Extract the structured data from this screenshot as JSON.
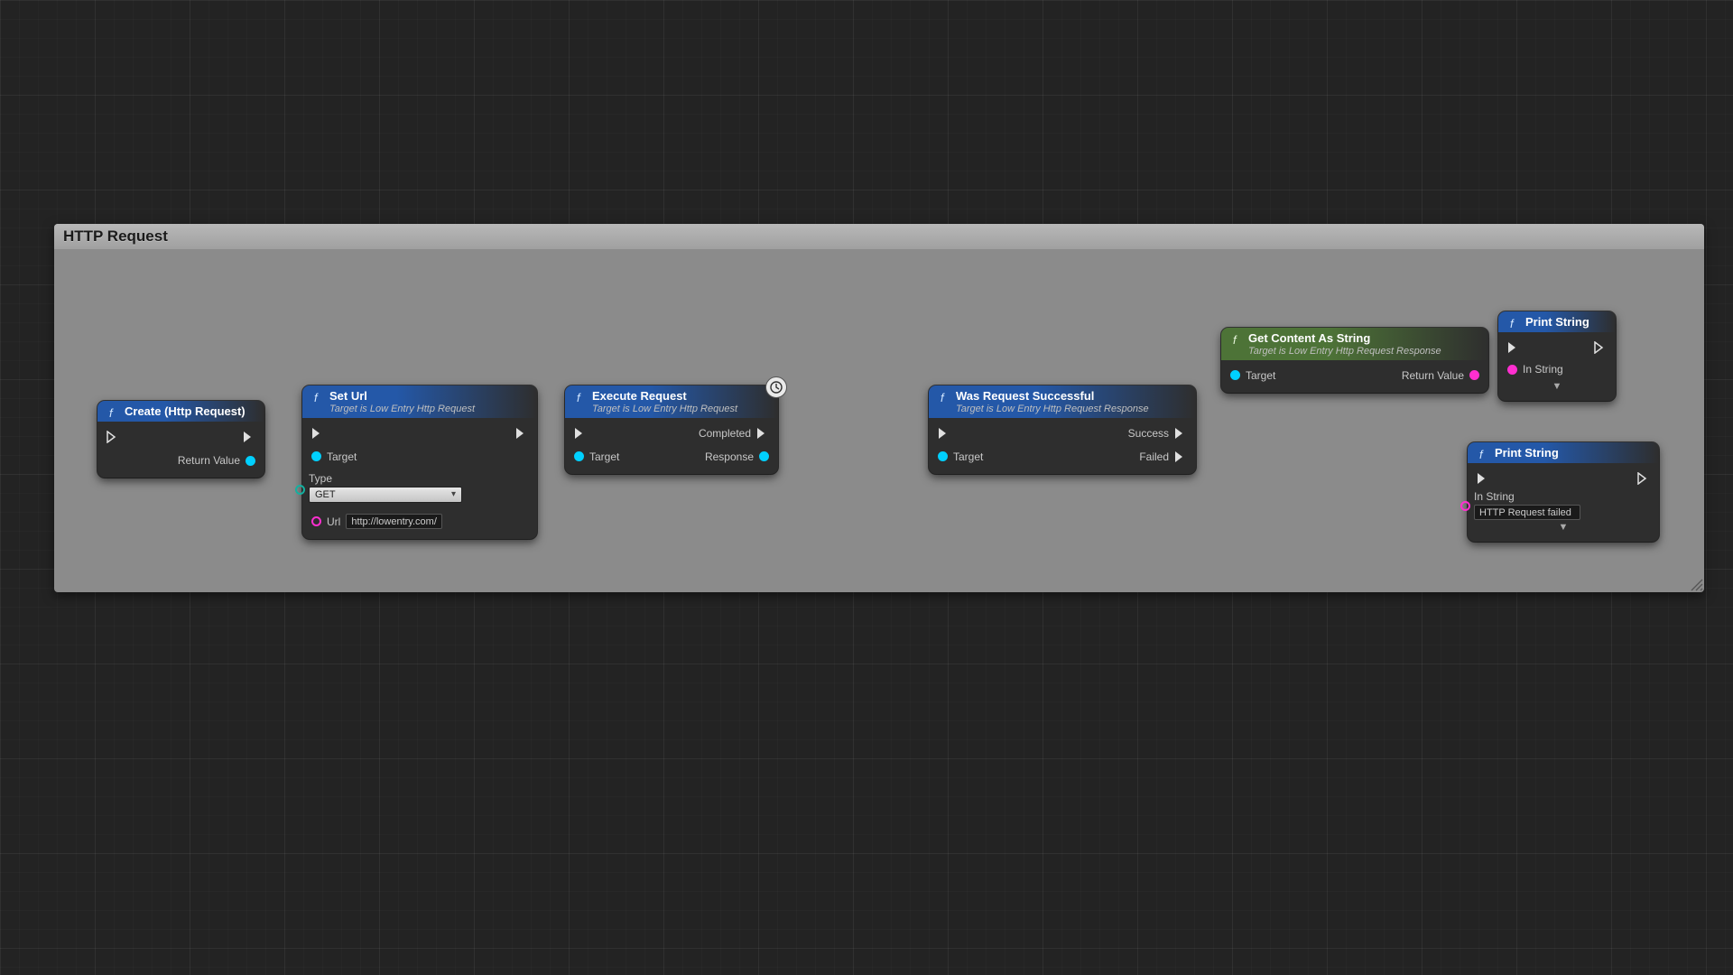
{
  "panel": {
    "title": "HTTP Request"
  },
  "nodes": {
    "create": {
      "title": "Create (Http Request)",
      "return": "Return Value"
    },
    "seturl": {
      "title": "Set Url",
      "subtitle": "Target is Low Entry Http Request",
      "target": "Target",
      "type_label": "Type",
      "type_value": "GET",
      "url_label": "Url",
      "url_value": "http://lowentry.com/"
    },
    "exec": {
      "title": "Execute Request",
      "subtitle": "Target is Low Entry Http Request",
      "target": "Target",
      "completed": "Completed",
      "response": "Response"
    },
    "success": {
      "title": "Was Request Successful",
      "subtitle": "Target is Low Entry Http Request Response",
      "target": "Target",
      "success": "Success",
      "failed": "Failed"
    },
    "content": {
      "title": "Get Content As String",
      "subtitle": "Target is Low Entry Http Request Response",
      "target": "Target",
      "return": "Return Value"
    },
    "print1": {
      "title": "Print String",
      "instring": "In String"
    },
    "print2": {
      "title": "Print String",
      "instring": "In String",
      "value": "HTTP Request failed"
    }
  },
  "colors": {
    "exec": "#e0e0e0",
    "object": "#00d0ff",
    "string": "#ff2fd0"
  }
}
